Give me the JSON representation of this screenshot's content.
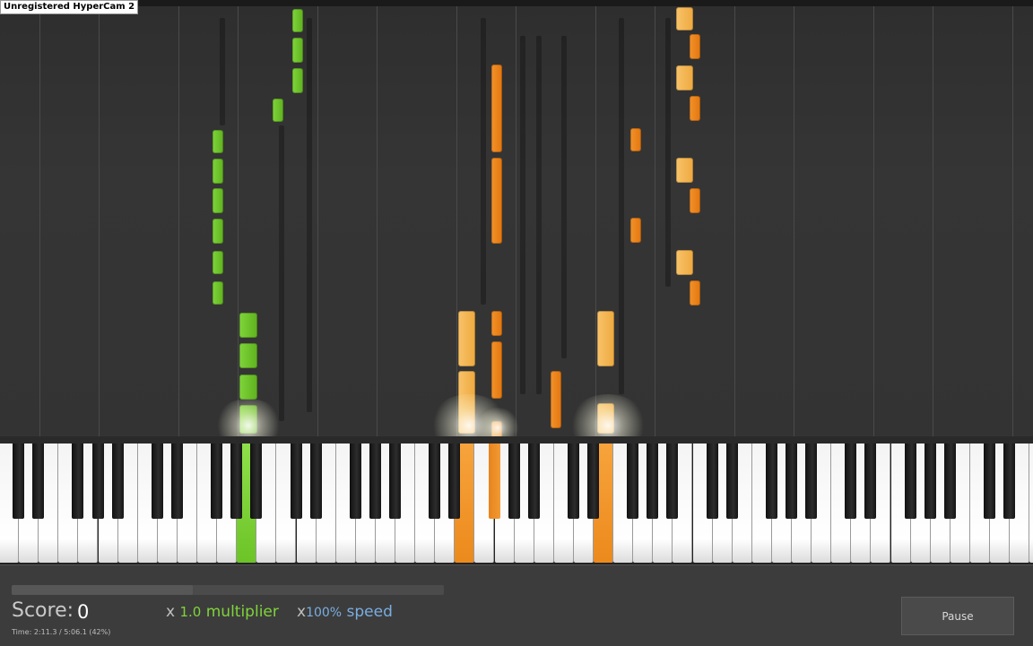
{
  "recorder": {
    "watermark": "Unregistered HyperCam 2"
  },
  "score": {
    "label": "Score:",
    "value": "0"
  },
  "multiplier": {
    "prefix": "x",
    "value": "1.0",
    "label": "multiplier"
  },
  "speed": {
    "prefix": "x",
    "value": "100%",
    "label": "speed"
  },
  "playback": {
    "time": "Time:  2:11.3 / 5:06.1 (42%)",
    "progress_percent": 42
  },
  "controls": {
    "pause_label": "Pause"
  },
  "colors": {
    "left_hand": "#6cc427",
    "right_hand": "#ec8a1c",
    "right_hand_light": "#f3b24e",
    "background": "#333333"
  },
  "keyboard": {
    "pressed_keys": [
      "green-key",
      "orange-key",
      "orange-key",
      "orange-black-key"
    ]
  }
}
